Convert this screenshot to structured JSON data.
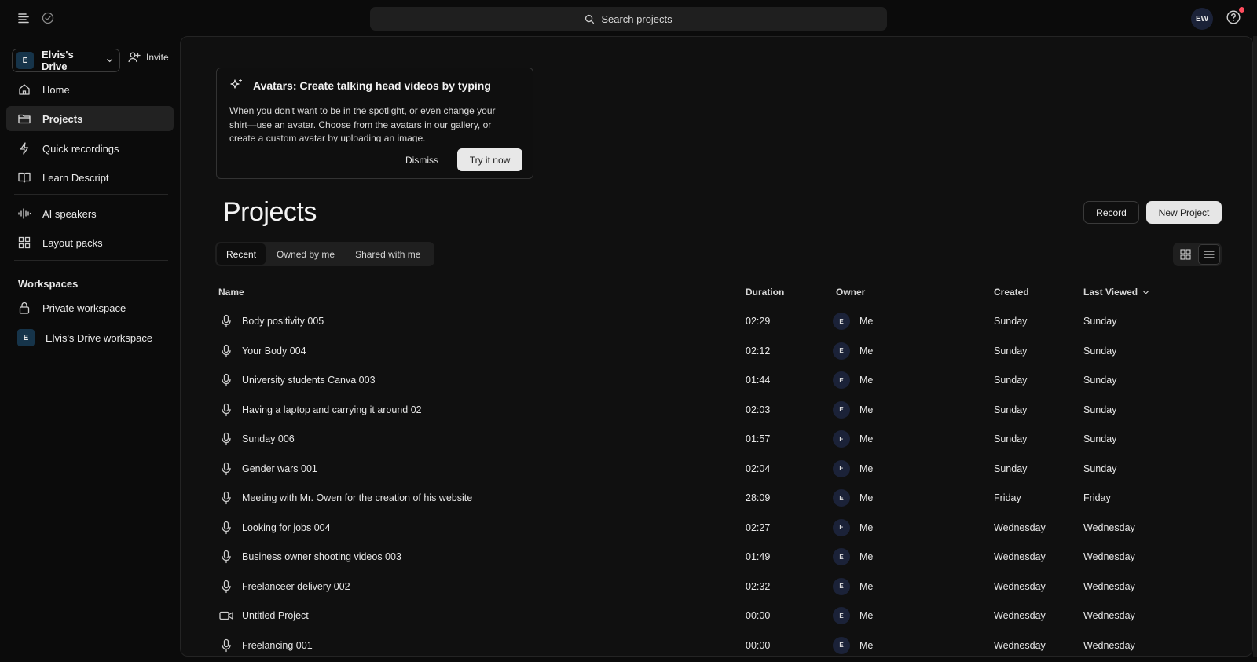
{
  "topbar": {
    "search_placeholder": "Search projects",
    "user_initials": "EW"
  },
  "sidebar": {
    "drive_initial": "E",
    "drive_name": "Elvis's Drive",
    "invite_label": "Invite",
    "nav": [
      {
        "label": "Home",
        "icon": "home-icon"
      },
      {
        "label": "Projects",
        "icon": "folder-icon",
        "active": true
      },
      {
        "label": "Quick recordings",
        "icon": "lightning-icon"
      },
      {
        "label": "Learn Descript",
        "icon": "book-icon"
      },
      {
        "label": "AI speakers",
        "icon": "waveform-icon"
      },
      {
        "label": "Layout packs",
        "icon": "grid-icon"
      }
    ],
    "workspaces_title": "Workspaces",
    "workspaces": [
      {
        "label": "Private workspace",
        "icon": "lock-icon"
      },
      {
        "label": "Elvis's Drive workspace",
        "initial": "E"
      }
    ]
  },
  "promo": {
    "title": "Avatars: Create talking head videos by typing",
    "body": "When you don't want to be in the spotlight, or even change your shirt—use an avatar. Choose from the avatars in our gallery, or create a custom avatar by uploading an image.",
    "dismiss_label": "Dismiss",
    "try_label": "Try it now"
  },
  "main": {
    "title": "Projects",
    "record_label": "Record",
    "new_project_label": "New Project",
    "tabs": [
      "Recent",
      "Owned by me",
      "Shared with me"
    ],
    "active_tab": "Recent"
  },
  "table": {
    "headers": {
      "name": "Name",
      "duration": "Duration",
      "owner": "Owner",
      "created": "Created",
      "last_viewed": "Last Viewed"
    },
    "rows": [
      {
        "name": "Body positivity 005",
        "duration": "02:29",
        "owner_initial": "E",
        "owner": "Me",
        "created": "Sunday",
        "last_viewed": "Sunday",
        "type": "audio"
      },
      {
        "name": "Your Body 004",
        "duration": "02:12",
        "owner_initial": "E",
        "owner": "Me",
        "created": "Sunday",
        "last_viewed": "Sunday",
        "type": "audio"
      },
      {
        "name": "University students Canva 003",
        "duration": "01:44",
        "owner_initial": "E",
        "owner": "Me",
        "created": "Sunday",
        "last_viewed": "Sunday",
        "type": "audio"
      },
      {
        "name": "Having a laptop and carrying it around 02",
        "duration": "02:03",
        "owner_initial": "E",
        "owner": "Me",
        "created": "Sunday",
        "last_viewed": "Sunday",
        "type": "audio"
      },
      {
        "name": "Sunday 006",
        "duration": "01:57",
        "owner_initial": "E",
        "owner": "Me",
        "created": "Sunday",
        "last_viewed": "Sunday",
        "type": "audio"
      },
      {
        "name": "Gender wars 001",
        "duration": "02:04",
        "owner_initial": "E",
        "owner": "Me",
        "created": "Sunday",
        "last_viewed": "Sunday",
        "type": "audio"
      },
      {
        "name": "Meeting with Mr. Owen for the creation of his website",
        "duration": "28:09",
        "owner_initial": "E",
        "owner": "Me",
        "created": "Friday",
        "last_viewed": "Friday",
        "type": "audio"
      },
      {
        "name": "Looking for jobs 004",
        "duration": "02:27",
        "owner_initial": "E",
        "owner": "Me",
        "created": "Wednesday",
        "last_viewed": "Wednesday",
        "type": "audio"
      },
      {
        "name": "Business owner shooting videos 003",
        "duration": "01:49",
        "owner_initial": "E",
        "owner": "Me",
        "created": "Wednesday",
        "last_viewed": "Wednesday",
        "type": "audio"
      },
      {
        "name": "Freelanceer delivery 002",
        "duration": "02:32",
        "owner_initial": "E",
        "owner": "Me",
        "created": "Wednesday",
        "last_viewed": "Wednesday",
        "type": "audio"
      },
      {
        "name": "Untitled Project",
        "duration": "00:00",
        "owner_initial": "E",
        "owner": "Me",
        "created": "Wednesday",
        "last_viewed": "Wednesday",
        "type": "video"
      },
      {
        "name": "Freelancing 001",
        "duration": "00:00",
        "owner_initial": "E",
        "owner": "Me",
        "created": "Wednesday",
        "last_viewed": "Wednesday",
        "type": "audio"
      }
    ]
  }
}
